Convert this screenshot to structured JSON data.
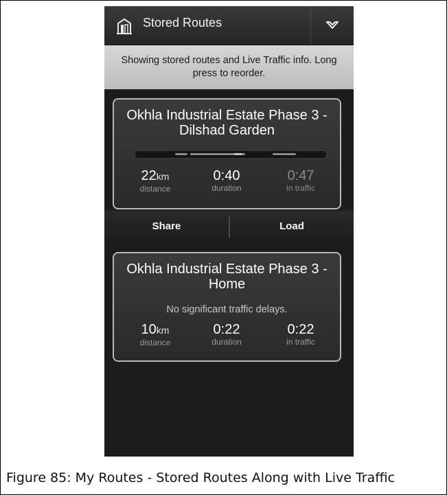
{
  "header": {
    "title": "Stored Routes",
    "title_icon": "stored-routes-icon",
    "menu_icon": "chevron-down-icon"
  },
  "info": {
    "text": "Showing stored routes and Live Traffic info. Long press to reorder."
  },
  "routes": [
    {
      "title": "Okhla Industrial Estate Phase 3 - Dilshad Garden",
      "distance_value": "22",
      "distance_unit": "km",
      "distance_label": "distance",
      "duration_value": "0:40",
      "duration_label": "duration",
      "traffic_value": "0:47",
      "traffic_label": "in traffic"
    },
    {
      "title": "Okhla Industrial Estate Phase 3 - Home",
      "status": "No significant traffic delays.",
      "distance_value": "10",
      "distance_unit": "km",
      "distance_label": "distance",
      "duration_value": "0:22",
      "duration_label": "duration",
      "traffic_value": "0:22",
      "traffic_label": "in traffic"
    }
  ],
  "actions": {
    "share": "Share",
    "load": "Load"
  },
  "caption": "Figure 85: My Routes - Stored Routes Along with Live Traffic"
}
